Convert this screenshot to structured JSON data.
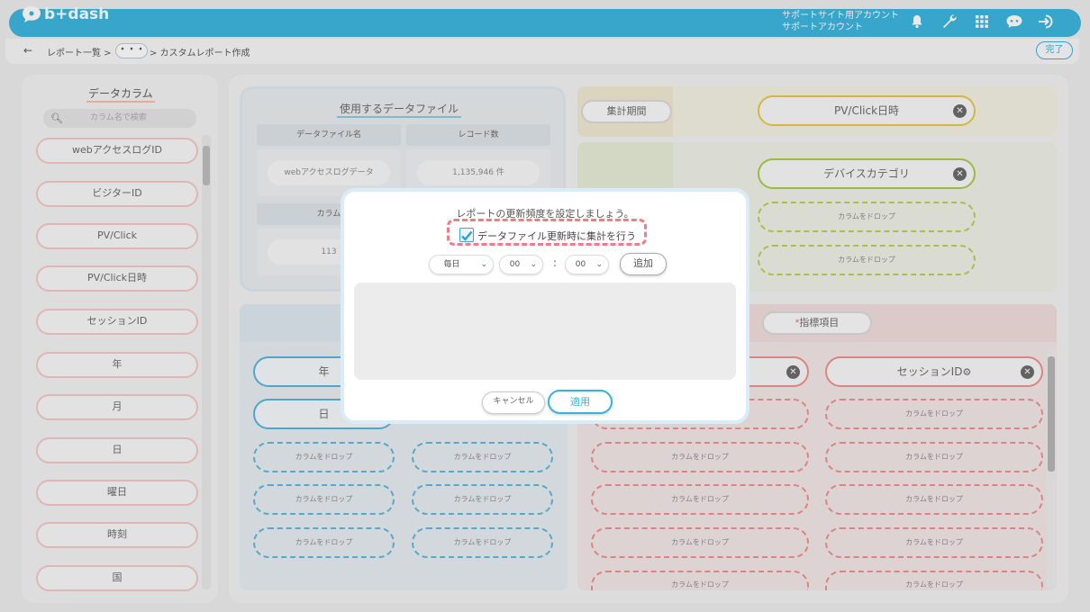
{
  "app": {
    "logo_text": "b+dash"
  },
  "header": {
    "account_line1": "サポートサイト用アカウント",
    "account_line2": "サポートアカウント"
  },
  "breadcrumb": {
    "back": "←",
    "item1": "レポート一覧 >",
    "more": "・・・",
    "item3": "> カスタムレポート作成"
  },
  "done_label": "完了",
  "left_panel": {
    "title": "データカラム",
    "search_placeholder": "カラム名で検索",
    "items": [
      "webアクセスログID",
      "ビジターID",
      "PV/Click",
      "PV/Click日時",
      "セッションID",
      "年",
      "月",
      "日",
      "曜日",
      "時刻",
      "国"
    ]
  },
  "file_panel": {
    "title": "使用するデータファイル",
    "col_name": "データファイル名",
    "col_records": "レコード数",
    "file_name": "webアクセスログデータ",
    "record_count": "1,135,946 件",
    "col_partial": "カラム",
    "partial_value": "113"
  },
  "period": {
    "label": "集計期間",
    "chip": "PV/Click日時"
  },
  "dimension": {
    "chip": "デバイスカテゴリ",
    "drop1": "カラムをドロップ",
    "drop2": "カラムをドロップ"
  },
  "rows": {
    "chip_year": "年",
    "chip_day": "日",
    "drops": [
      "カラムをドロップ",
      "カラムをドロップ",
      "カラムをドロップ",
      "カラムをドロップ",
      "カラムをドロップ",
      "カラムをドロップ"
    ]
  },
  "metrics": {
    "label_req": "*",
    "label": "指標項目",
    "chip_session": "セッションID",
    "drops": [
      "カラムをドロップ",
      "カラムをドロップ",
      "カラムをドロップ",
      "カラムをドロップ",
      "カラムをドロップ",
      "カラムをドロップ",
      "カラムをドロップ",
      "カラムをドロップ",
      "カラムをドロップ",
      "カラムをドロップ"
    ]
  },
  "modal": {
    "title": "レポートの更新頻度を設定しましょう。",
    "checkbox_label": "データファイル更新時に集計を行う",
    "checkbox_checked": true,
    "frequency": "毎日",
    "hour": "00",
    "colon": ":",
    "minute": "00",
    "add_label": "追加",
    "cancel_label": "キャンセル",
    "apply_label": "適用"
  },
  "colors": {
    "accent": "#36b3dc",
    "highlight": "#f07c86"
  }
}
